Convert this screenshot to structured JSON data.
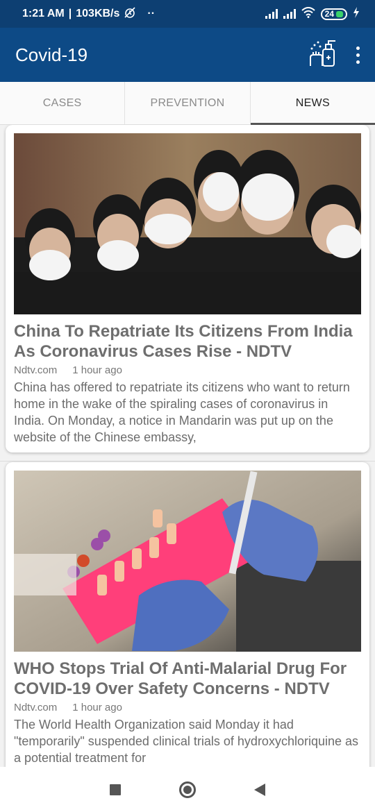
{
  "status_bar": {
    "time": "1:21 AM",
    "speed": "103KB/s",
    "dots": "··",
    "battery_level": "24"
  },
  "app_bar": {
    "title": "Covid-19"
  },
  "tabs": [
    {
      "label": "CASES",
      "active": false
    },
    {
      "label": "PREVENTION",
      "active": false
    },
    {
      "label": "NEWS",
      "active": true
    }
  ],
  "articles": [
    {
      "title": "China To Repatriate Its Citizens From India As Coronavirus Cases Rise - NDTV",
      "source": "Ndtv.com",
      "time": "1 hour ago",
      "description": "China has offered to repatriate its citizens who want to return home in the wake of the spiraling cases of coronavirus in India. On Monday, a notice in Mandarin was put up on the website of the Chinese embassy,"
    },
    {
      "title": "WHO Stops Trial Of Anti-Malarial Drug For COVID-19 Over Safety Concerns - NDTV",
      "source": "Ndtv.com",
      "time": "1 hour ago",
      "description": "The World Health Organization said Monday it had \"temporarily\" suspended clinical trials of hydroxychloriquine as a potential treatment for"
    }
  ],
  "icons": {
    "app_action": "hand-sanitizer-icon",
    "overflow": "more-vert-icon",
    "nav": [
      "recents-square-icon",
      "home-circle-icon",
      "back-triangle-icon"
    ]
  },
  "colors": {
    "app_bar": "#0d4a86",
    "status_bar": "#0d3f72",
    "active_tab_indicator": "#555555"
  }
}
